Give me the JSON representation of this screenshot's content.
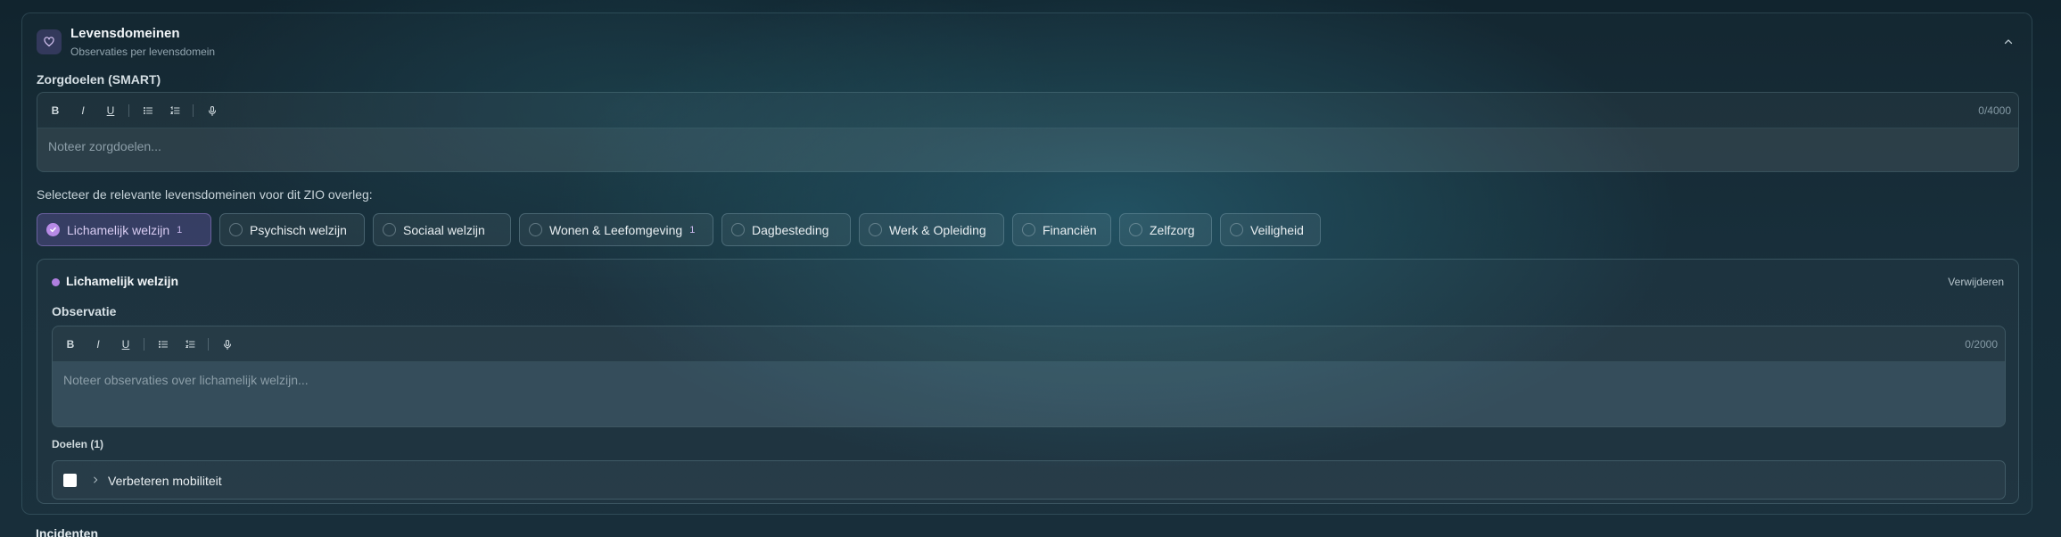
{
  "section": {
    "title": "Levensdomeinen",
    "subtitle": "Observaties per levensdomein",
    "icon": "heart-icon",
    "toggle_icon": "chevron-up-icon"
  },
  "care_goals": {
    "label": "Zorgdoelen (SMART)",
    "counter": "0/4000",
    "placeholder": "Noteer zorgdoelen..."
  },
  "toolbar": {
    "bold": "B",
    "italic": "I",
    "underline": "U"
  },
  "domains_prompt": "Selecteer de relevante levensdomeinen voor dit ZIO overleg:",
  "domains": [
    {
      "label": "Lichamelijk welzijn",
      "count": "1",
      "selected": true
    },
    {
      "label": "Psychisch welzijn",
      "count": "",
      "selected": false
    },
    {
      "label": "Sociaal welzijn",
      "count": "",
      "selected": false
    },
    {
      "label": "Wonen & Leefomgeving",
      "count": "1",
      "selected": false
    },
    {
      "label": "Dagbesteding",
      "count": "",
      "selected": false
    },
    {
      "label": "Werk & Opleiding",
      "count": "",
      "selected": false
    },
    {
      "label": "Financiën",
      "count": "",
      "selected": false
    },
    {
      "label": "Zelfzorg",
      "count": "",
      "selected": false
    },
    {
      "label": "Veiligheid",
      "count": "",
      "selected": false
    }
  ],
  "domain_card": {
    "title": "Lichamelijk welzijn",
    "remove_label": "Verwijderen",
    "observation_label": "Observatie",
    "observation_counter": "0/2000",
    "observation_placeholder": "Noteer observaties over lichamelijk welzijn...",
    "goals_label": "Doelen (1)",
    "goals": [
      {
        "label": "Verbeteren mobiliteit"
      }
    ]
  },
  "next_section_label": "Incidenten",
  "colors": {
    "accent_purple": "#b07fe0",
    "chip_active_bg": "#4b3f78"
  }
}
